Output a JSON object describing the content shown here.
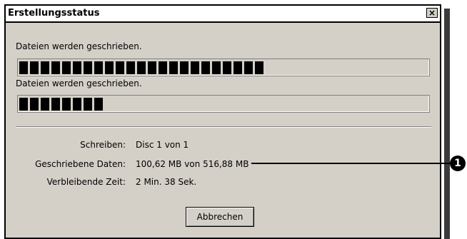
{
  "window": {
    "title": "Erstellungsstatus",
    "close_symbol": "×"
  },
  "progress": [
    {
      "label": "Dateien werden geschrieben.",
      "blocks": 23
    },
    {
      "label": "Dateien werden geschrieben.",
      "blocks": 8
    }
  ],
  "details": [
    {
      "key": "Schreiben:",
      "value": "Disc 1 von 1"
    },
    {
      "key": "Geschriebene Daten:",
      "value": "100,62 MB von 516,88 MB"
    },
    {
      "key": "Verbleibende Zeit:",
      "value": "2 Min. 38 Sek."
    }
  ],
  "buttons": {
    "cancel": "Abbrechen"
  },
  "callout": {
    "number": "1"
  }
}
